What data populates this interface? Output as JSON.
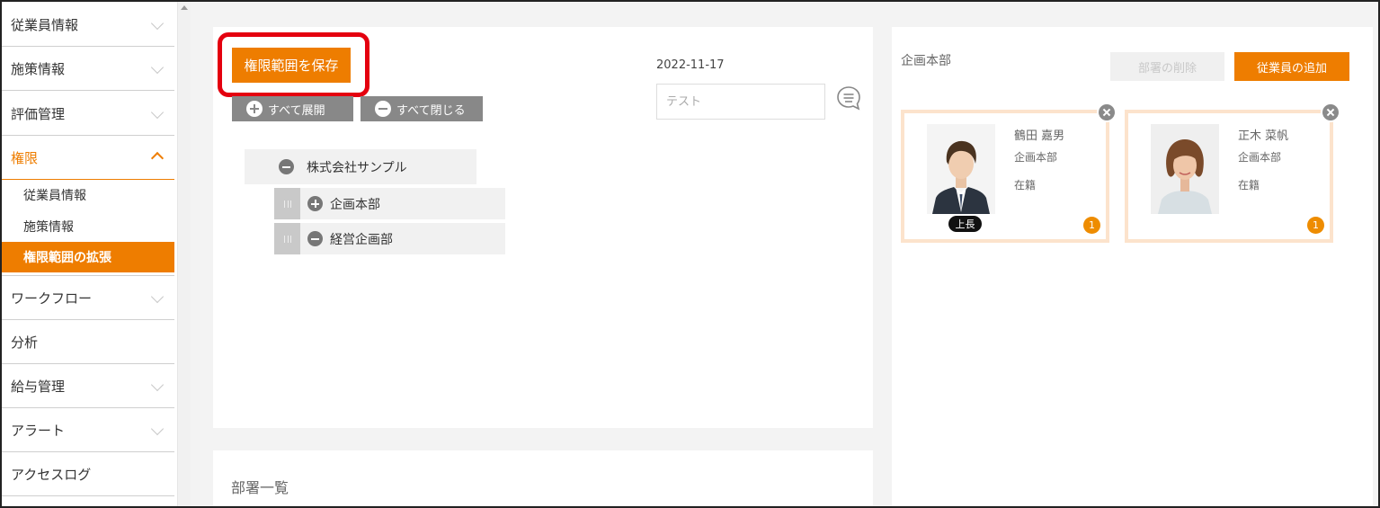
{
  "sidebar": {
    "items": [
      {
        "label": "従業員情報"
      },
      {
        "label": "施策情報"
      },
      {
        "label": "評価管理"
      },
      {
        "label": "権限"
      },
      {
        "label": "ワークフロー"
      },
      {
        "label": "分析"
      },
      {
        "label": "給与管理"
      },
      {
        "label": "アラート"
      },
      {
        "label": "アクセスログ"
      }
    ],
    "subitems": [
      {
        "label": "従業員情報"
      },
      {
        "label": "施策情報"
      },
      {
        "label": "権限範囲の拡張"
      }
    ]
  },
  "toolbar": {
    "save_label": "権限範囲を保存",
    "expand_all": "すべて展開",
    "collapse_all": "すべて閉じる"
  },
  "memo": {
    "date": "2022-11-17",
    "placeholder": "テスト"
  },
  "tree": {
    "root": "株式会社サンプル",
    "children": [
      {
        "label": "企画本部"
      },
      {
        "label": "経営企画部"
      }
    ]
  },
  "dept_list": {
    "title": "部署一覧"
  },
  "detail": {
    "title": "企画本部",
    "delete_label": "部署の削除",
    "add_label": "従業員の追加",
    "employees": [
      {
        "name": "鶴田 嘉男",
        "dept": "企画本部",
        "status": "在籍",
        "role": "上長",
        "count": "1"
      },
      {
        "name": "正木 菜帆",
        "dept": "企画本部",
        "status": "在籍",
        "count": "1"
      }
    ]
  },
  "colors": {
    "accent": "#ee7d00",
    "highlight": "#e4000f"
  }
}
